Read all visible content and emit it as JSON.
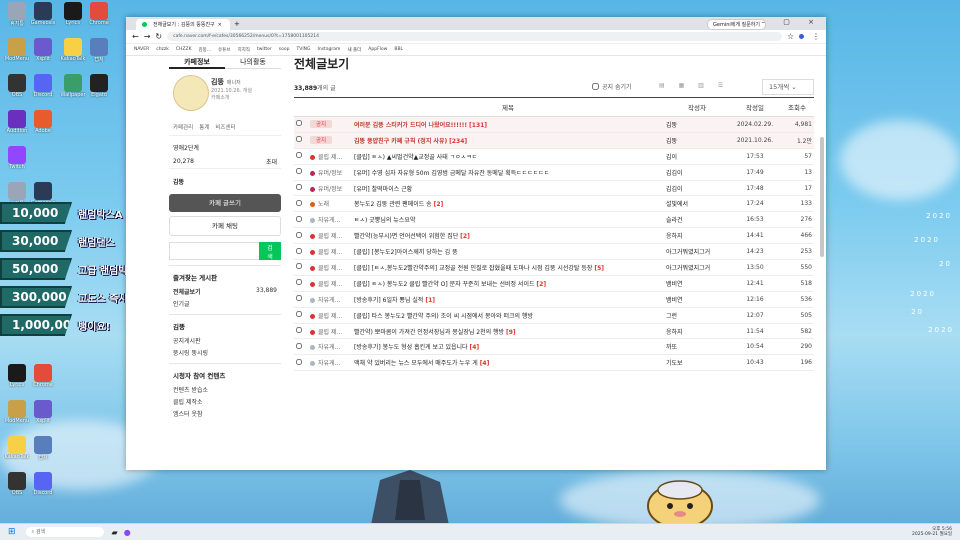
{
  "donations": [
    {
      "amount": "10,000",
      "label": "랜덤박스A"
    },
    {
      "amount": "30,000",
      "label": "랜덤댄스"
    },
    {
      "amount": "50,000",
      "label": "고급 랜덤박스A"
    },
    {
      "amount": "300,000",
      "label": "고도스 즉시 출소"
    },
    {
      "amount": "1,000,000",
      "label": "뱅이요!"
    }
  ],
  "desktop_icons": [
    "휴지통",
    "Gameosis",
    "Lyrics",
    "Chrome",
    "ModMenu",
    "Xsplit",
    "KakaoTalk",
    "캡처",
    "OBS",
    "Discord",
    "Wallpaper",
    "Elgato",
    "Audition",
    "Adobe",
    "Twitch"
  ],
  "decor_right": [
    "2020",
    "2020",
    "20",
    "2020",
    "20",
    "2020"
  ],
  "browser": {
    "tab_title": "전체글보기 : 김뚱의 뚱뚱친구",
    "gemini": "Gemini에게 질문하기",
    "url": "cafe.naver.com/f-e/cafes/30566252/menus/0?t=1758001105214",
    "bookmarks": [
      "NAVER",
      "chzzk",
      "CHZZK",
      "김뚱...",
      "유튜브",
      "치지직",
      "twitter",
      "soop",
      "TVING",
      "Instagram",
      "새 폴더",
      "AppFlow",
      "BBL"
    ]
  },
  "sidebar": {
    "tabs": [
      "카페정보",
      "나의활동"
    ],
    "profile_name": "김뚱",
    "profile_role": "매니저",
    "profile_since": "2021.10.26. 개설",
    "profile_sub": "카페소개",
    "links": [
      "카페관리",
      "통계",
      "비즈센터"
    ],
    "level": "영애2단계",
    "members": "20,278",
    "invite": "초대",
    "host": "김뚱",
    "write_btn": "카페 글쓰기",
    "chat_btn": "카페 채팅",
    "search_btn": "검색",
    "fav_title": "즐겨찾는 게시판",
    "all_board": "전체글보기",
    "all_count": "33,889",
    "popular": "인기글",
    "section_host": "김뚱",
    "host_items": [
      "공지게시판",
      "뚱시링 뚱시링"
    ],
    "section_viewers": "시청자 참여 컨텐츠",
    "viewer_items": [
      "컨텐츠 받습소",
      "클립 제작소",
      "엠스터 웃참"
    ]
  },
  "main": {
    "title": "전체글보기",
    "count": "33,889",
    "count_suffix": "개의 글",
    "notice_toggle": "공지 숨기기",
    "per_page": "15개씩",
    "columns": [
      "제목",
      "작성자",
      "작성일",
      "조회수"
    ],
    "rows": [
      {
        "type": "notice",
        "cat": "공지",
        "title": "여러분 김뚱 스티커가 드디어 나왔어요!!!!!!",
        "comments": "[131]",
        "author": "김뚱",
        "date": "2024.02.29.",
        "views": "4,981"
      },
      {
        "type": "notice",
        "cat": "공지",
        "title": "김뚱 뚱얍친구 카페 규칙 (정지 사유)",
        "comments": "[234]",
        "author": "김뚱",
        "date": "2021.10.26.",
        "views": "1.2만"
      },
      {
        "type": "post",
        "dot": "#e03131",
        "cat": "클립 제...",
        "title": "[클립] ㅌㅅ) ▲씨멀건약▲교정골 사태 ㄱㅇㅅㅋㄷ",
        "comments": "",
        "author": "김이",
        "date": "17:53",
        "views": "57"
      },
      {
        "type": "post",
        "dot": "#c2255c",
        "cat": "유머/정보",
        "title": "[유머] 수영 심자 자유형 50m 김영범 금메달 자유잔 동메달 획득ㄷㄷㄷㄷㄷㄷ",
        "comments": "",
        "author": "김김이",
        "date": "17:49",
        "views": "13"
      },
      {
        "type": "post",
        "dot": "#c2255c",
        "cat": "유머/정보",
        "title": "[유머] 찰떡마이스 근황",
        "comments": "",
        "author": "김김이",
        "date": "17:48",
        "views": "17"
      },
      {
        "type": "post",
        "dot": "#e8590c",
        "cat": "노래",
        "title": "봉누도2 김뚱 관련 팬메이드 송",
        "comments": "[2]",
        "author": "설빛에서",
        "date": "17:24",
        "views": "133"
      },
      {
        "type": "post",
        "dot": "#adb5bd",
        "cat": "자유게...",
        "title": "ㅌㅅ) 긋뿡님의 뉴스요약",
        "comments": "",
        "author": "슬라건",
        "date": "16:53",
        "views": "276"
      },
      {
        "type": "post",
        "dot": "#e03131",
        "cat": "클립 제...",
        "title": "빨간약(능부시)면 언어선택이 위험한 집단",
        "comments": "[2]",
        "author": "응하지",
        "date": "14:41",
        "views": "466"
      },
      {
        "type": "post",
        "dot": "#e03131",
        "cat": "클립 제...",
        "title": "[클립] [봉누도2]아이스께끼 당하는 김 뚱",
        "comments": "",
        "author": "아그거뭐였지그거",
        "date": "14:23",
        "views": "253"
      },
      {
        "type": "post",
        "dot": "#e03131",
        "cat": "클립 제...",
        "title": "[클립] [ㅌㅅ,봉누도2빨간약주의] 교정골 전원 인질로 잡혔을때 도마나 시점 김뚱 시선강탈 등장",
        "comments": "[5]",
        "author": "아그거뭐였지그거",
        "date": "13:50",
        "views": "550"
      },
      {
        "type": "post",
        "dot": "#e03131",
        "cat": "클립 제...",
        "title": "[클립] ㅌㅅ) 봉누도2 클립 빨간약 O] 문자 꾸준히 보내는 선비정 서이드",
        "comments": "[2]",
        "author": "뱀비연",
        "date": "12:41",
        "views": "518"
      },
      {
        "type": "post",
        "dot": "#adb5bd",
        "cat": "자유게...",
        "title": "[방송후기] 6일차 뿅님 실적",
        "comments": "[1]",
        "author": "뱀비연",
        "date": "12:16",
        "views": "536"
      },
      {
        "type": "post",
        "dot": "#e03131",
        "cat": "클립 제...",
        "title": "[클립] 타스 봉누도2 빨간약 주의) 조이 씨 시점에서 몽아와 떠크의 행방",
        "comments": "",
        "author": "그런",
        "date": "12:07",
        "views": "505"
      },
      {
        "type": "post",
        "dot": "#e03131",
        "cat": "클립 제...",
        "title": "빨간약) 뽀마콤이 가져간 인정서장님과 몽실장님 2천의 행방",
        "comments": "[9]",
        "author": "응하지",
        "date": "11:54",
        "views": "582"
      },
      {
        "type": "post",
        "dot": "#adb5bd",
        "cat": "자유게...",
        "title": "[방송후기] 봉누도 형성 흡킨게 보고 있읍니다",
        "comments": "[4]",
        "author": "까또",
        "date": "10:54",
        "views": "290"
      },
      {
        "type": "post",
        "dot": "#adb5bd",
        "cat": "자유게...",
        "title": "액채 약 있버리는 뉴스 모두에서 매주도가 누우 게",
        "comments": "[4]",
        "author": "기도보",
        "date": "10:43",
        "views": "196"
      }
    ]
  },
  "taskbar": {
    "search": "검색",
    "time": "오후 5:56",
    "date": "2025-09-21 월요일"
  }
}
